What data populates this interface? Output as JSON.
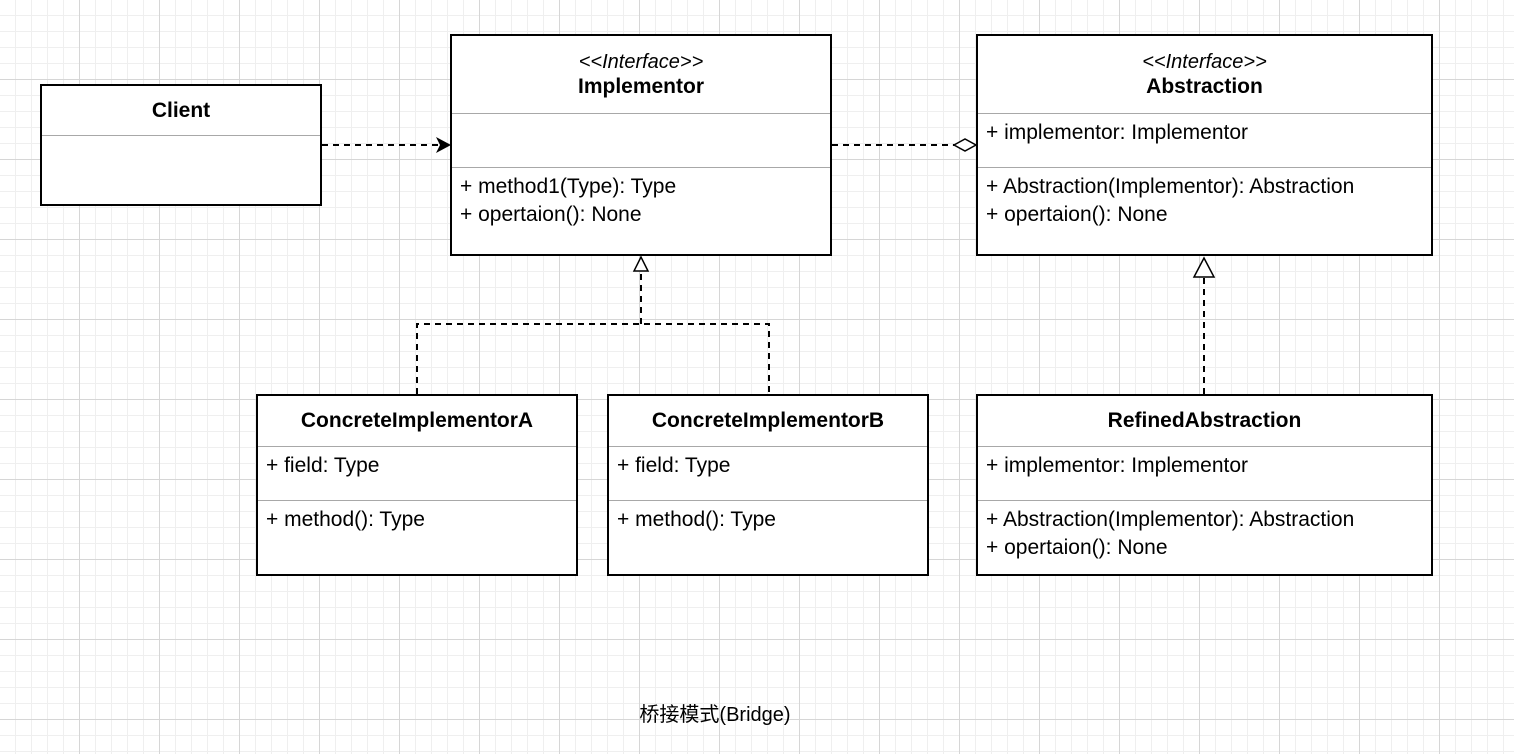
{
  "classes": {
    "client": {
      "name": "Client",
      "attributes": [],
      "operations": []
    },
    "implementor": {
      "stereotype": "<<Interface>>",
      "name": "Implementor",
      "attributes": [],
      "operations": [
        "+ method1(Type): Type",
        "+ opertaion(): None"
      ]
    },
    "abstraction": {
      "stereotype": "<<Interface>>",
      "name": "Abstraction",
      "attributes": [
        "+ implementor: Implementor"
      ],
      "operations": [
        "+ Abstraction(Implementor): Abstraction",
        "+ opertaion(): None"
      ]
    },
    "concrete_a": {
      "name": "ConcreteImplementorA",
      "attributes": [
        "+ field: Type"
      ],
      "operations": [
        "+ method(): Type"
      ]
    },
    "concrete_b": {
      "name": "ConcreteImplementorB",
      "attributes": [
        "+ field: Type"
      ],
      "operations": [
        "+ method(): Type"
      ]
    },
    "refined_abstraction": {
      "name": "RefinedAbstraction",
      "attributes": [
        "+ implementor: Implementor"
      ],
      "operations": [
        "+ Abstraction(Implementor): Abstraction",
        "+ opertaion(): None"
      ]
    }
  },
  "relationships": [
    {
      "from": "Client",
      "to": "Implementor",
      "type": "dependency"
    },
    {
      "from": "Abstraction",
      "to": "Implementor",
      "type": "aggregation"
    },
    {
      "from": "ConcreteImplementorA",
      "to": "Implementor",
      "type": "realization"
    },
    {
      "from": "ConcreteImplementorB",
      "to": "Implementor",
      "type": "realization"
    },
    {
      "from": "RefinedAbstraction",
      "to": "Abstraction",
      "type": "realization"
    }
  ],
  "caption": "桥接模式(Bridge)"
}
